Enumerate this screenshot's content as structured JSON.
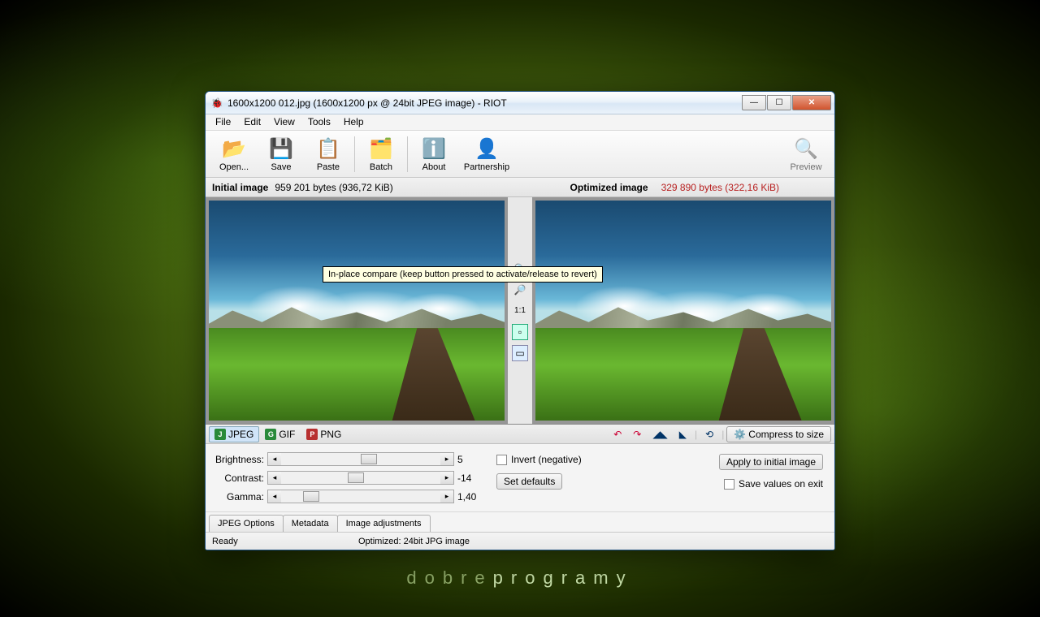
{
  "watermark": {
    "light": "dobre",
    "bold": "programy"
  },
  "window": {
    "title": "1600x1200 012.jpg (1600x1200 px @ 24bit JPEG image) - RIOT"
  },
  "menu": [
    "File",
    "Edit",
    "View",
    "Tools",
    "Help"
  ],
  "toolbar": {
    "open": "Open...",
    "save": "Save",
    "paste": "Paste",
    "batch": "Batch",
    "about": "About",
    "partnership": "Partnership",
    "preview": "Preview"
  },
  "sizebar": {
    "initial_lbl": "Initial image",
    "initial_val": "959 201 bytes (936,72 KiB)",
    "opt_lbl": "Optimized image",
    "opt_val": "329 890 bytes (322,16 KiB)"
  },
  "midtools": {
    "one_to_one": "1:1"
  },
  "tooltip": "In-place compare (keep button pressed to activate/release to revert)",
  "formats": {
    "jpeg": "JPEG",
    "gif": "GIF",
    "png": "PNG"
  },
  "compress": "Compress to size",
  "adjust": {
    "brightness_lbl": "Brightness:",
    "brightness_val": "5",
    "contrast_lbl": "Contrast:",
    "contrast_val": "-14",
    "gamma_lbl": "Gamma:",
    "gamma_val": "1,40",
    "invert": "Invert (negative)",
    "setdef": "Set defaults",
    "apply": "Apply to initial image",
    "saveexit": "Save values on exit"
  },
  "lowtabs": {
    "jpeg": "JPEG Options",
    "meta": "Metadata",
    "img": "Image adjustments"
  },
  "status": {
    "ready": "Ready",
    "opt": "Optimized: 24bit JPG image"
  }
}
